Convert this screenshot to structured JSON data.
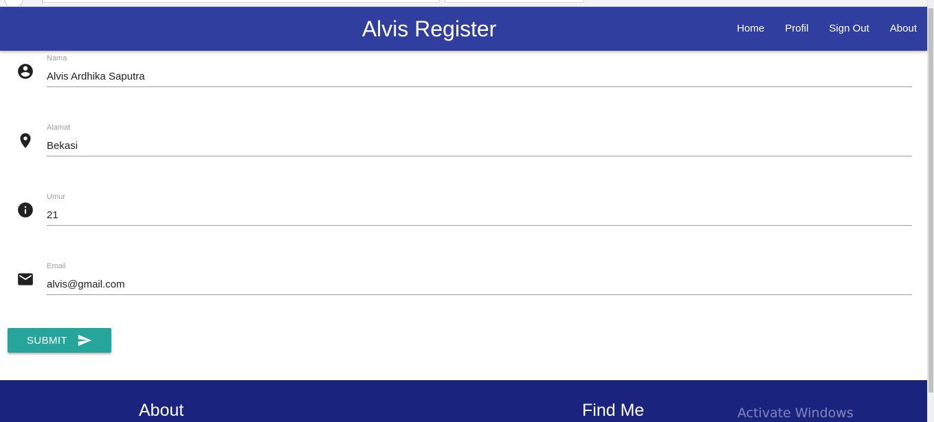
{
  "navbar": {
    "brand": "Alvis Register",
    "links": [
      "Home",
      "Profil",
      "Sign Out",
      "About"
    ]
  },
  "form": {
    "fields": [
      {
        "label": "Nama",
        "value": "Alvis Ardhika Saputra",
        "icon": "account-circle-icon"
      },
      {
        "label": "Alamat",
        "value": "Bekasi",
        "icon": "location-pin-icon"
      },
      {
        "label": "Umur",
        "value": "21",
        "icon": "info-icon"
      },
      {
        "label": "Email",
        "value": "alvis@gmail.com",
        "icon": "email-icon"
      }
    ],
    "submit_label": "SUBMIT",
    "submit_icon": "send-icon"
  },
  "footer": {
    "about_title": "About",
    "findme_title": "Find Me"
  },
  "overlay": {
    "watermark": "Activate Windows"
  },
  "colors": {
    "navbar": "#303f9f",
    "footer": "#1a237e",
    "submit": "#26a69a"
  }
}
